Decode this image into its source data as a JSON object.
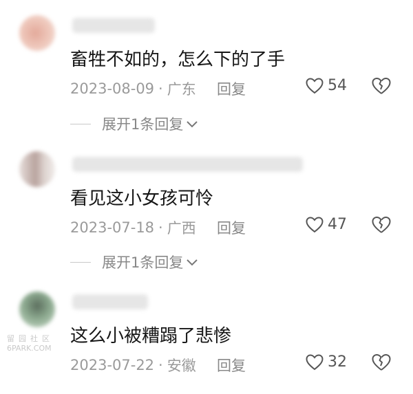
{
  "comments": [
    {
      "text": "畜牲不如的，怎么下的了手",
      "date": "2023-08-09",
      "separator": "·",
      "location": "广东",
      "reply_label": "回复",
      "likes": "54",
      "expand_label": "展开1条回复",
      "avatar_color": "#e8b4a8"
    },
    {
      "text": "看见这小女孩可怜",
      "date": "2023-07-18",
      "separator": "·",
      "location": "广西",
      "reply_label": "回复",
      "likes": "47",
      "expand_label": "展开1条回复",
      "avatar_color": "#cfc6c2"
    },
    {
      "text": "这么小被糟蹋了悲惨",
      "date": "2023-07-22",
      "separator": "·",
      "location": "安徽",
      "reply_label": "回复",
      "likes": "32",
      "avatar_color": "#8ba88e"
    }
  ],
  "watermark": {
    "line1": "留园社区",
    "line2": "6PARK.COM"
  }
}
